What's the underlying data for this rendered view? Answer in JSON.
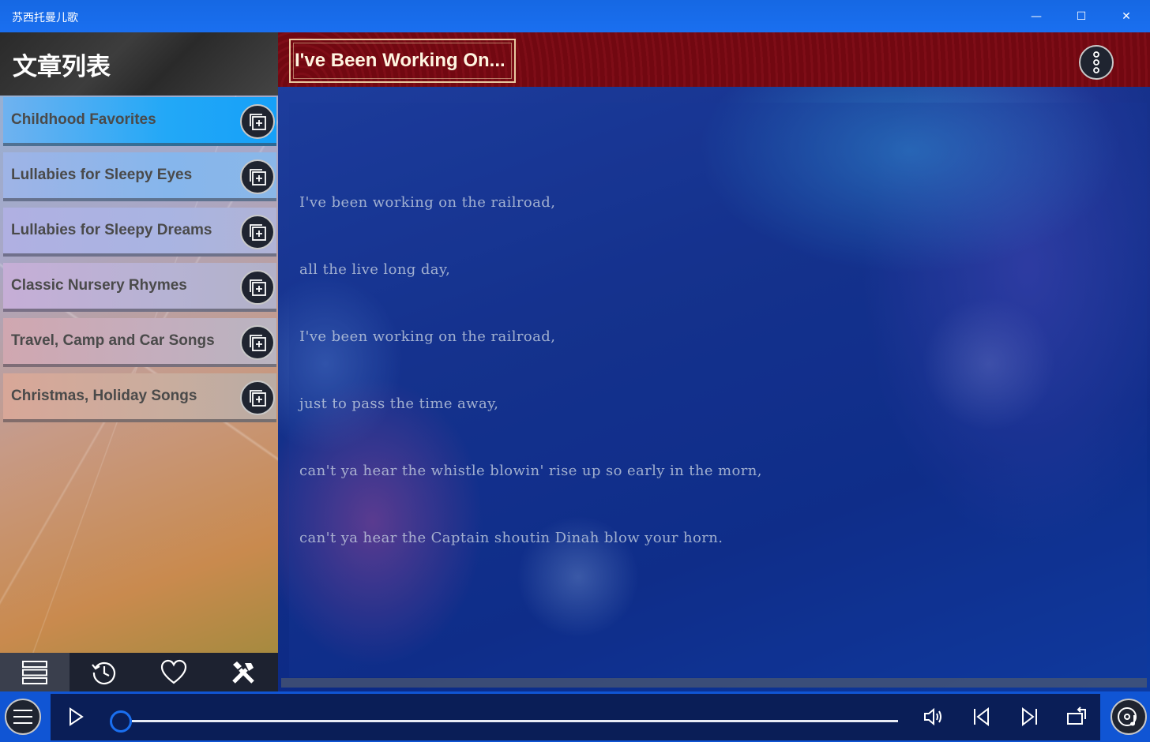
{
  "window": {
    "title": "苏西托曼儿歌",
    "minimize_icon": "—",
    "maximize_icon": "☐",
    "close_icon": "✕"
  },
  "sidebar": {
    "heading": "文章列表",
    "categories": [
      {
        "label": "Childhood Favorites"
      },
      {
        "label": "Lullabies for Sleepy Eyes"
      },
      {
        "label": "Lullabies for Sleepy Dreams"
      },
      {
        "label": "Classic Nursery Rhymes"
      },
      {
        "label": "Travel, Camp and Car Songs"
      },
      {
        "label": "Christmas, Holiday Songs"
      }
    ],
    "tabs": [
      {
        "icon": "list-icon",
        "active": true
      },
      {
        "icon": "history-icon",
        "active": false
      },
      {
        "icon": "heart-icon",
        "active": false
      },
      {
        "icon": "tools-icon",
        "active": false
      }
    ]
  },
  "song": {
    "title": "I've Been Working On...",
    "lyrics": [
      "I've been working on the railroad,",
      "all the live long day,",
      "I've been working on the railroad,",
      "just to pass the time away,",
      "can't ya hear the whistle blowin' rise up so early in the morn,",
      "can't ya hear the Captain shoutin Dinah blow your horn."
    ]
  },
  "player": {
    "progress": 0.0,
    "icons": [
      "menu-icon",
      "play-icon",
      "volume-icon",
      "previous-icon",
      "next-icon",
      "repeat-icon",
      "disc-icon"
    ]
  },
  "colors": {
    "titlebar": "#1a6ff0",
    "header_red": "#7a0d16",
    "player_bg": "#0a1e57",
    "accent": "#1a6ff0"
  }
}
